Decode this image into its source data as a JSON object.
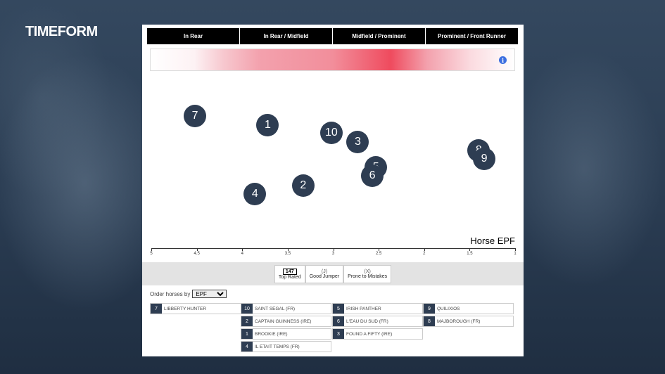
{
  "brand": {
    "logo_text": "TIMEFORM"
  },
  "tabs": [
    "In Rear",
    "In Rear / Midfield",
    "Midfield / Prominent",
    "Prominent / Front Runner"
  ],
  "heat_strip": {
    "info_icon": "info-icon",
    "info_glyph": "i"
  },
  "chart_data": {
    "type": "scatter",
    "xlabel": "Horse EPF",
    "xlim": [
      5,
      1
    ],
    "ticks": [
      "5",
      "4.5",
      "4",
      "3.5",
      "3",
      "2.5",
      "2",
      "1.5",
      "1"
    ],
    "points": [
      {
        "label": "7",
        "epf": 4.52
      },
      {
        "label": "1",
        "epf": 3.72
      },
      {
        "label": "10",
        "epf": 3.02
      },
      {
        "label": "3",
        "epf": 2.73
      },
      {
        "label": "5",
        "epf": 2.53
      },
      {
        "label": "6",
        "epf": 2.57
      },
      {
        "label": "2",
        "epf": 3.33
      },
      {
        "label": "4",
        "epf": 3.86
      },
      {
        "label": "8",
        "epf": 1.4
      },
      {
        "label": "9",
        "epf": 1.34
      }
    ]
  },
  "legend": [
    {
      "key": "147",
      "label": "Top Rated"
    },
    {
      "key": "(J)",
      "label": "Good Jumper"
    },
    {
      "key": "(X)",
      "label": "Prone to Mistakes"
    }
  ],
  "order": {
    "label": "Order horses by",
    "selected": "EPF"
  },
  "horse_list": [
    {
      "num": "7",
      "name": "LIBBERTY HUNTER"
    },
    {
      "num": "10",
      "name": "SAINT SEGAL (FR)"
    },
    {
      "num": "2",
      "name": "CAPTAIN GUINNESS (IRE)"
    },
    {
      "num": "1",
      "name": "BROOKIE (IRE)"
    },
    {
      "num": "4",
      "name": "IL ETAIT TEMPS (FR)"
    },
    {
      "num": "5",
      "name": "IRISH PANTHER"
    },
    {
      "num": "6",
      "name": "L'EAU DU SUD (FR)"
    },
    {
      "num": "3",
      "name": "FOUND A FIFTY (IRE)"
    },
    {
      "num": "9",
      "name": "QUILIXIOS"
    },
    {
      "num": "8",
      "name": "MAJBOROUGH (FR)"
    }
  ]
}
